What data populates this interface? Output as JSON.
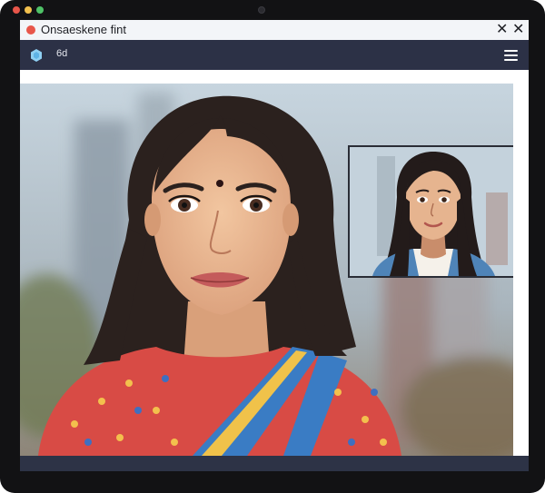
{
  "window": {
    "title": "Onsaeskene fint",
    "close_glyph": "✕",
    "close_glyph_alt": "✕"
  },
  "navbar": {
    "label": "6d",
    "logo_icon": "hexagon-logo-icon",
    "menu_icon": "hamburger-menu-icon"
  },
  "colors": {
    "device_bezel": "#121214",
    "navbar": "#2c3146",
    "dot_red": "#e8564a",
    "dot_yellow": "#f2c14e",
    "dot_green": "#4fc267",
    "logo": "#8fd0f3"
  }
}
